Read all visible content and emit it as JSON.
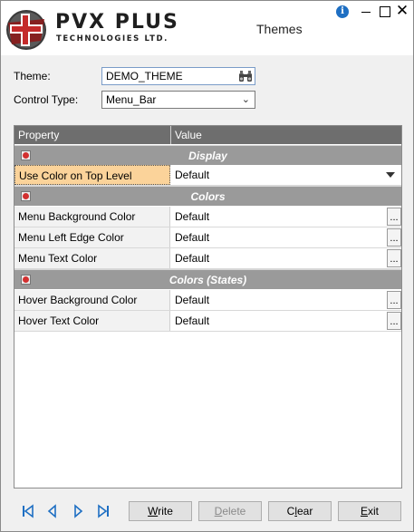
{
  "brand": {
    "name": "PVX PLUS",
    "subtitle": "TECHNOLOGIES LTD."
  },
  "window": {
    "title": "Themes",
    "info_icon": "info-icon",
    "close_glyph": "✕"
  },
  "form": {
    "theme_label": "Theme:",
    "theme_value": "DEMO_THEME",
    "control_type_label": "Control Type:",
    "control_type_value": "Menu_Bar"
  },
  "grid": {
    "columns": [
      "Property",
      "Value"
    ],
    "groups": [
      {
        "title": "Display",
        "rows": [
          {
            "property": "Use Color on Top Level",
            "value": "Default"
          }
        ]
      },
      {
        "title": "Colors",
        "rows": [
          {
            "property": "Menu Background Color",
            "value": "Default"
          },
          {
            "property": "Menu Left Edge Color",
            "value": "Default"
          },
          {
            "property": "Menu Text Color",
            "value": "Default"
          }
        ]
      },
      {
        "title": "Colors (States)",
        "rows": [
          {
            "property": "Hover Background Color",
            "value": "Default"
          },
          {
            "property": "Hover Text Color",
            "value": "Default"
          }
        ]
      }
    ],
    "ellipsis": "..."
  },
  "toolbar": {
    "write": {
      "hot": "W",
      "rest": "rite"
    },
    "delete": {
      "hot": "D",
      "rest": "elete"
    },
    "clear": {
      "pre": "C",
      "hot": "l",
      "rest": "ear"
    },
    "exit": {
      "hot": "E",
      "rest": "xit"
    }
  },
  "colors": {
    "accent": "#1e6fc3",
    "header_bg": "#6e6e6e",
    "group_bg": "#9a9a9a",
    "selected_bg": "#fbd39a",
    "nav_icon": "#1e6fc3"
  }
}
